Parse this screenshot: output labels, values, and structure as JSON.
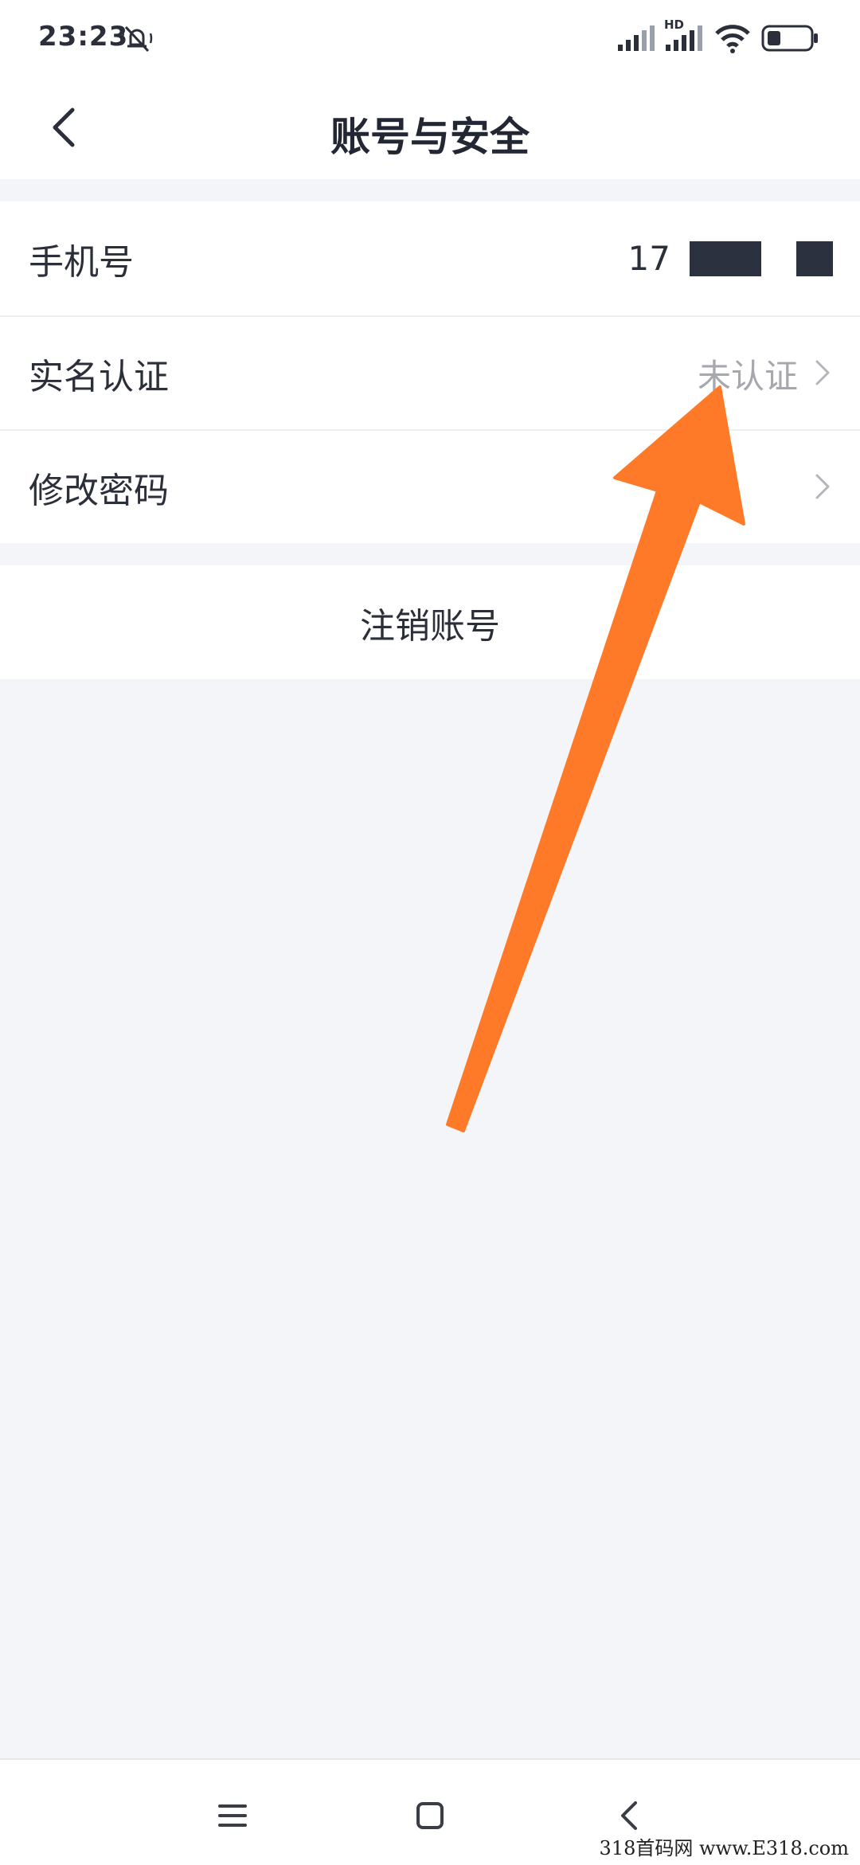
{
  "status_bar": {
    "time": "23:23",
    "signal_label": "HD",
    "icons": [
      "mute-icon",
      "signal-icon",
      "signal-hd-icon",
      "wifi-icon",
      "battery-icon"
    ]
  },
  "nav": {
    "title": "账号与安全",
    "back_icon": "back-chevron-icon"
  },
  "settings": {
    "items": [
      {
        "label": "手机号",
        "value": "17"
      },
      {
        "label": "实名认证",
        "value": "未认证"
      },
      {
        "label": "修改密码",
        "value": ""
      }
    ]
  },
  "logout": {
    "label": "注销账号"
  },
  "bottom_nav": {
    "icons": [
      "menu-icon",
      "home-square-icon",
      "back-triangle-icon"
    ]
  },
  "annotation": {
    "arrow_color": "#ff7a28"
  },
  "watermark": {
    "text": "318首码网 www.E318.com"
  }
}
